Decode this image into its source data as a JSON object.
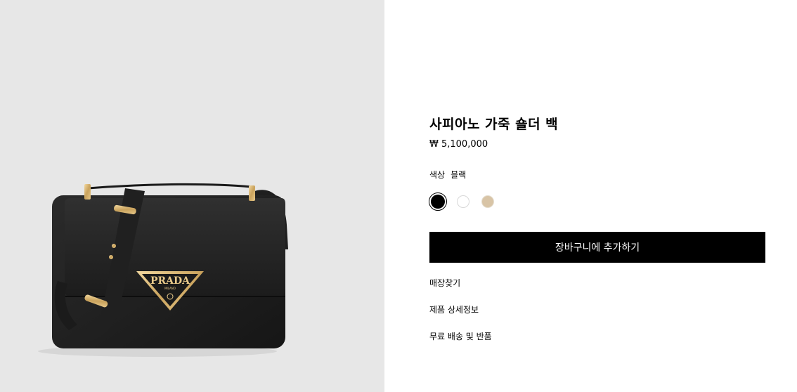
{
  "product": {
    "title": "사피아노 가죽 숄더 백",
    "price": "₩ 5,100,000",
    "color_label": "색상",
    "color_value": "블랙",
    "swatches": [
      {
        "name": "black",
        "color": "#000000",
        "selected": true
      },
      {
        "name": "white",
        "color": "#ffffff",
        "selected": false
      },
      {
        "name": "beige",
        "color": "#d8c4a6",
        "selected": false
      }
    ],
    "add_to_cart_label": "장바구니에 추가하기"
  },
  "logo": {
    "brand": "PRADA",
    "sub": "MILANO"
  },
  "links": {
    "store_finder": "매장찾기",
    "product_details": "제품 상세정보",
    "shipping_returns": "무료 배송 및 반품"
  }
}
